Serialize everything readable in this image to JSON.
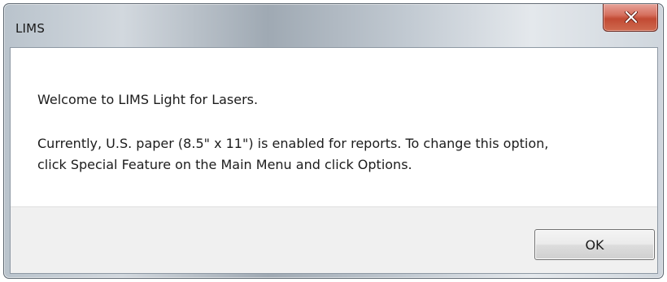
{
  "window": {
    "title": "LIMS"
  },
  "title_bar": {
    "close_icon": "close-x-icon"
  },
  "message": {
    "line1": "Welcome to LIMS Light for Lasers.",
    "line2": "Currently, U.S. paper (8.5\" x 11\") is enabled for reports.  To change this option,",
    "line3": "click Special Feature on the Main Menu and click Options."
  },
  "buttons": {
    "ok_label": "OK"
  },
  "colors": {
    "close_button": "#c24a33",
    "button_area": "#f0f0f0"
  }
}
